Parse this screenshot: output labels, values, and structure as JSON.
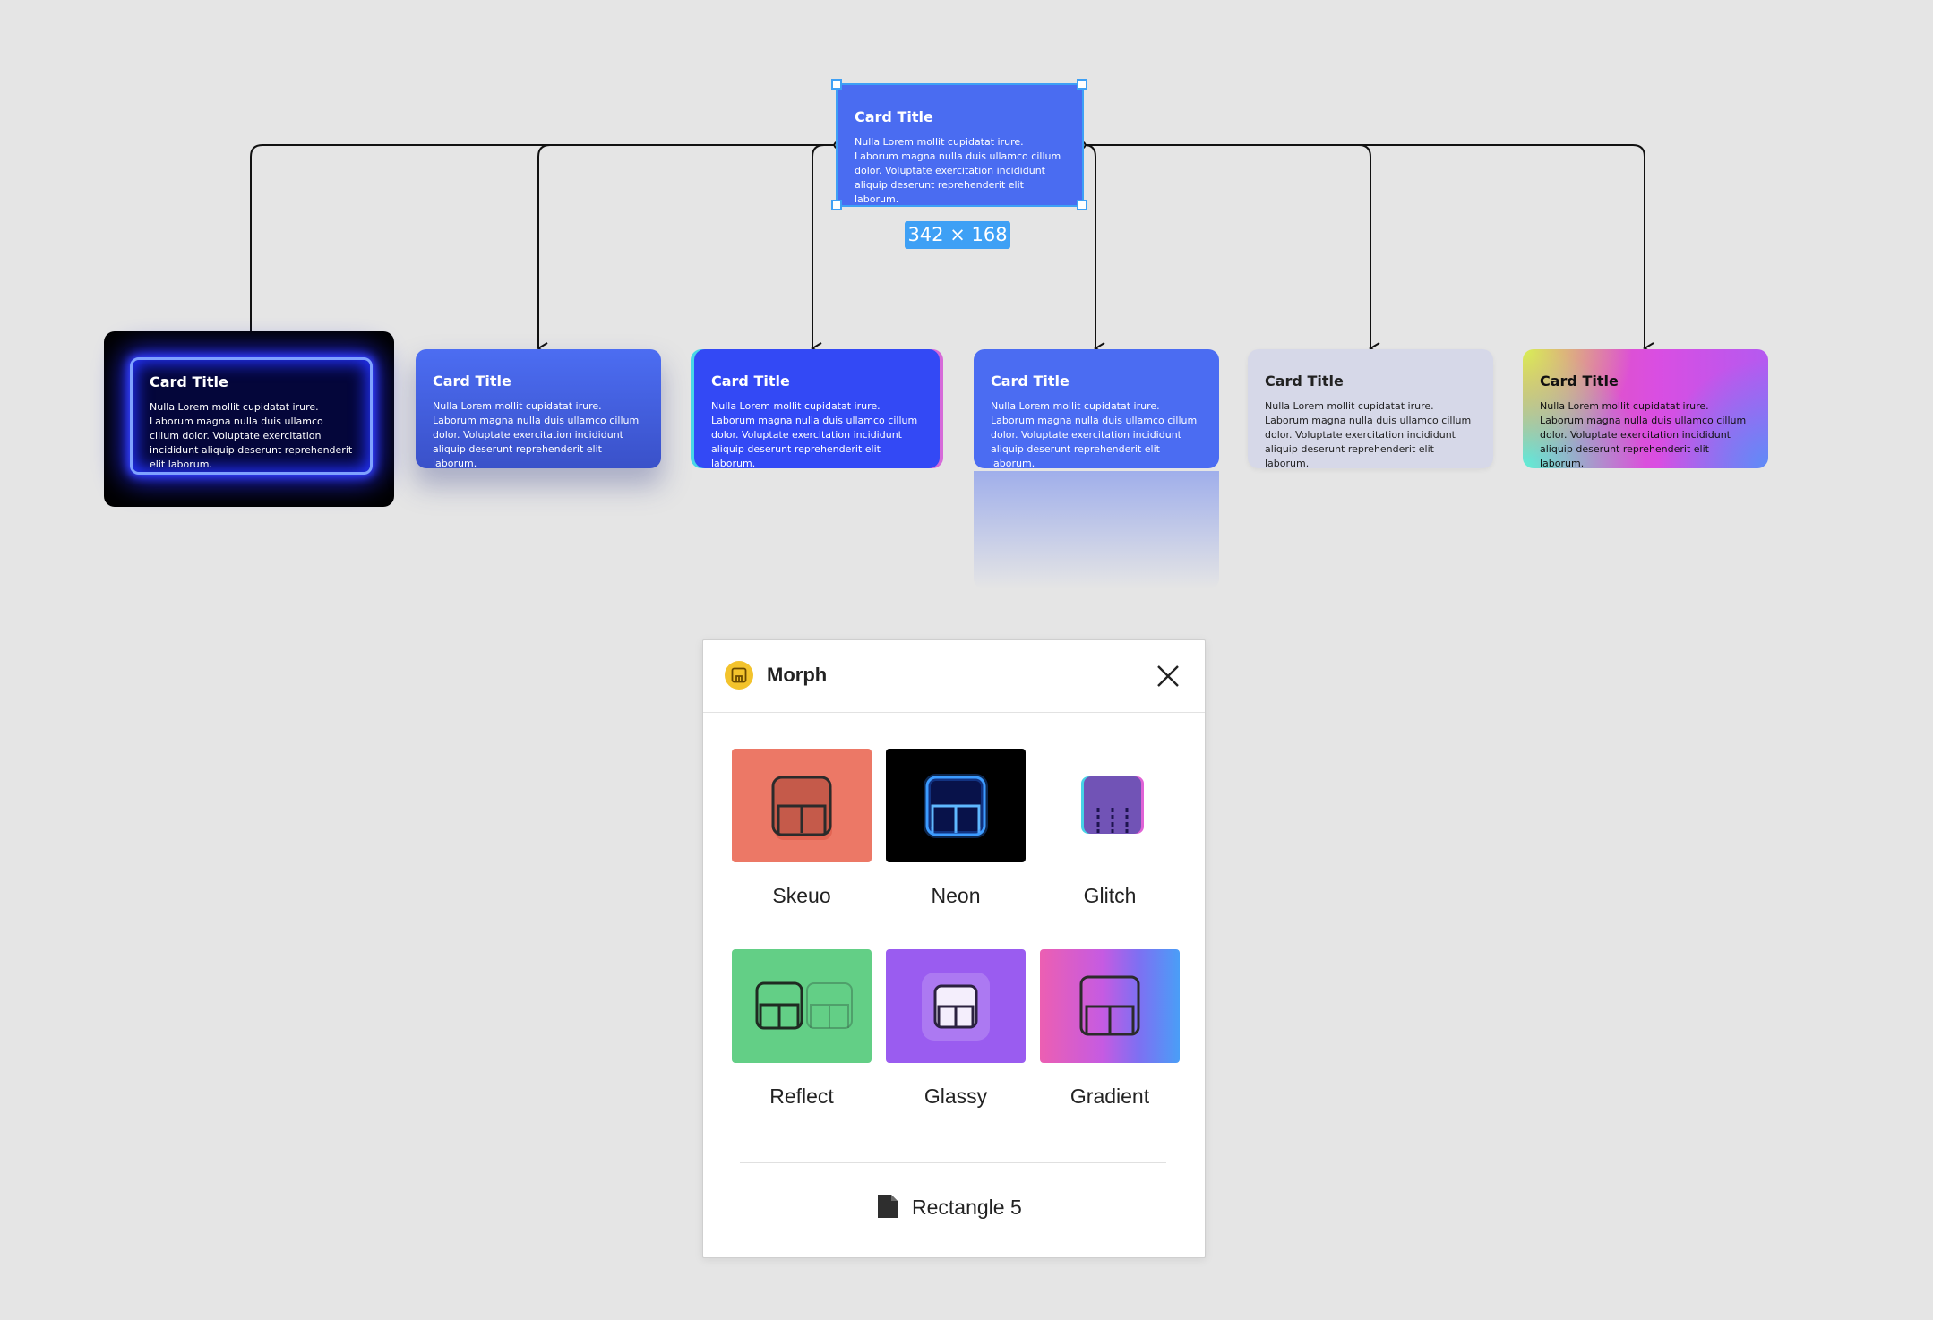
{
  "source_card": {
    "title": "Card Title",
    "body": "Nulla Lorem mollit cupidatat irure. Laborum magna nulla duis ullamco cillum dolor. Voluptate exercitation incididunt aliquip deserunt reprehenderit elit laborum."
  },
  "dimensions_label": "342 × 168",
  "variants": [
    {
      "style": "Neon",
      "title": "Card Title",
      "body": "Nulla Lorem mollit cupidatat irure. Laborum magna nulla duis ullamco cillum dolor. Voluptate exercitation incididunt aliquip deserunt reprehenderit elit laborum."
    },
    {
      "style": "Skeuo",
      "title": "Card Title",
      "body": "Nulla Lorem mollit cupidatat irure. Laborum magna nulla duis ullamco cillum dolor. Voluptate exercitation incididunt aliquip deserunt reprehenderit elit laborum."
    },
    {
      "style": "Glitch",
      "title": "Card Title",
      "body": "Nulla Lorem mollit cupidatat irure. Laborum magna nulla duis ullamco cillum dolor. Voluptate exercitation incididunt aliquip deserunt reprehenderit elit laborum."
    },
    {
      "style": "Reflect",
      "title": "Card Title",
      "body": "Nulla Lorem mollit cupidatat irure. Laborum magna nulla duis ullamco cillum dolor. Voluptate exercitation incididunt aliquip deserunt reprehenderit elit laborum."
    },
    {
      "style": "Glassy",
      "title": "Card Title",
      "body": "Nulla Lorem mollit cupidatat irure. Laborum magna nulla duis ullamco cillum dolor. Voluptate exercitation incididunt aliquip deserunt reprehenderit elit laborum."
    },
    {
      "style": "Gradient",
      "title": "Card Title",
      "body": "Nulla Lorem mollit cupidatat irure. Laborum magna nulla duis ullamco cillum dolor. Voluptate exercitation incididunt aliquip deserunt reprehenderit elit laborum."
    }
  ],
  "plugin": {
    "name": "Morph",
    "logo_icon": "morph-logo-icon",
    "close_icon": "close-icon",
    "styles": [
      {
        "label": "Skeuo",
        "color": "#ec7866"
      },
      {
        "label": "Neon",
        "color": "#000000"
      },
      {
        "label": "Glitch",
        "color": "#ffffff"
      },
      {
        "label": "Reflect",
        "color": "#63cf86"
      },
      {
        "label": "Glassy",
        "color": "#9a5cf0"
      },
      {
        "label": "Gradient",
        "color": "#d85cc9"
      }
    ],
    "selection_icon": "file-icon",
    "selection_name": "Rectangle 5"
  },
  "colors": {
    "canvas": "#e5e5e5",
    "accent": "#3ea0f5",
    "card_blue": "#4a6cf1"
  }
}
